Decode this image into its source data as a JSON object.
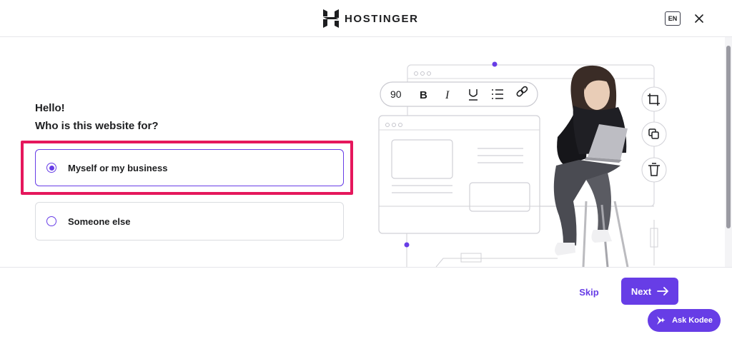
{
  "header": {
    "brand_name": "HOSTINGER",
    "language_label": "EN"
  },
  "main": {
    "greeting": "Hello!",
    "question": "Who is this website for?",
    "options": [
      {
        "label": "Myself or my business",
        "selected": true
      },
      {
        "label": "Someone else",
        "selected": false
      }
    ]
  },
  "editor_toolbar": {
    "font_size": "90"
  },
  "footer": {
    "skip_label": "Skip",
    "next_label": "Next",
    "assistant_label": "Ask Kodee"
  },
  "colors": {
    "accent": "#673de6",
    "highlight": "#e5175c",
    "text": "#1d1e20",
    "border": "#dadce0"
  }
}
